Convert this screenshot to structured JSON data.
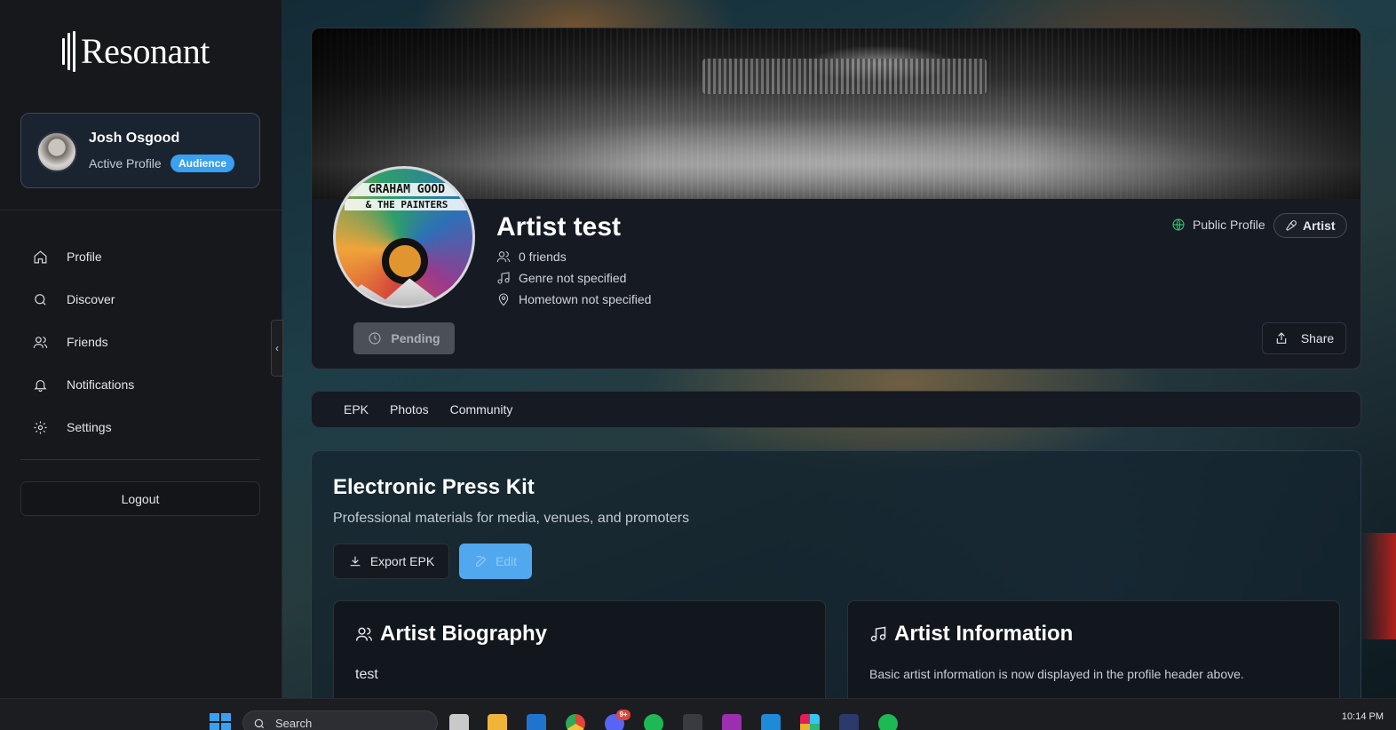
{
  "app": {
    "brand": "Resonant"
  },
  "sidebar": {
    "user": {
      "name": "Josh Osgood",
      "subtitle": "Active Profile",
      "badge": "Audience"
    },
    "nav": [
      {
        "label": "Profile",
        "icon": "home-icon"
      },
      {
        "label": "Discover",
        "icon": "search-icon"
      },
      {
        "label": "Friends",
        "icon": "users-icon"
      },
      {
        "label": "Notifications",
        "icon": "bell-icon"
      },
      {
        "label": "Settings",
        "icon": "gear-icon"
      }
    ],
    "logout_label": "Logout"
  },
  "artist": {
    "logo_text_line1": "GRAHAM GOOD",
    "logo_text_line2": "& THE PAINTERS",
    "name": "Artist test",
    "friends": "0 friends",
    "genre": "Genre not specified",
    "hometown": "Hometown not specified",
    "visibility": "Public Profile",
    "type_chip": "Artist",
    "pending_label": "Pending",
    "share_label": "Share"
  },
  "tabs": [
    {
      "label": "EPK"
    },
    {
      "label": "Photos"
    },
    {
      "label": "Community"
    }
  ],
  "epk": {
    "title": "Electronic Press Kit",
    "subtitle": "Professional materials for media, venues, and promoters",
    "export_label": "Export EPK",
    "edit_label": "Edit",
    "biography": {
      "title": "Artist Biography",
      "body": "test"
    },
    "information": {
      "title": "Artist Information",
      "body": "Basic artist information is now displayed in the profile header above."
    }
  },
  "taskbar": {
    "search_placeholder": "Search",
    "notification_badge": "9+",
    "clock": "10:14 PM"
  },
  "colors": {
    "accent": "#3aa0f0",
    "online": "#27c36c",
    "panel": "#161a22",
    "sidebar": "#17181b"
  }
}
